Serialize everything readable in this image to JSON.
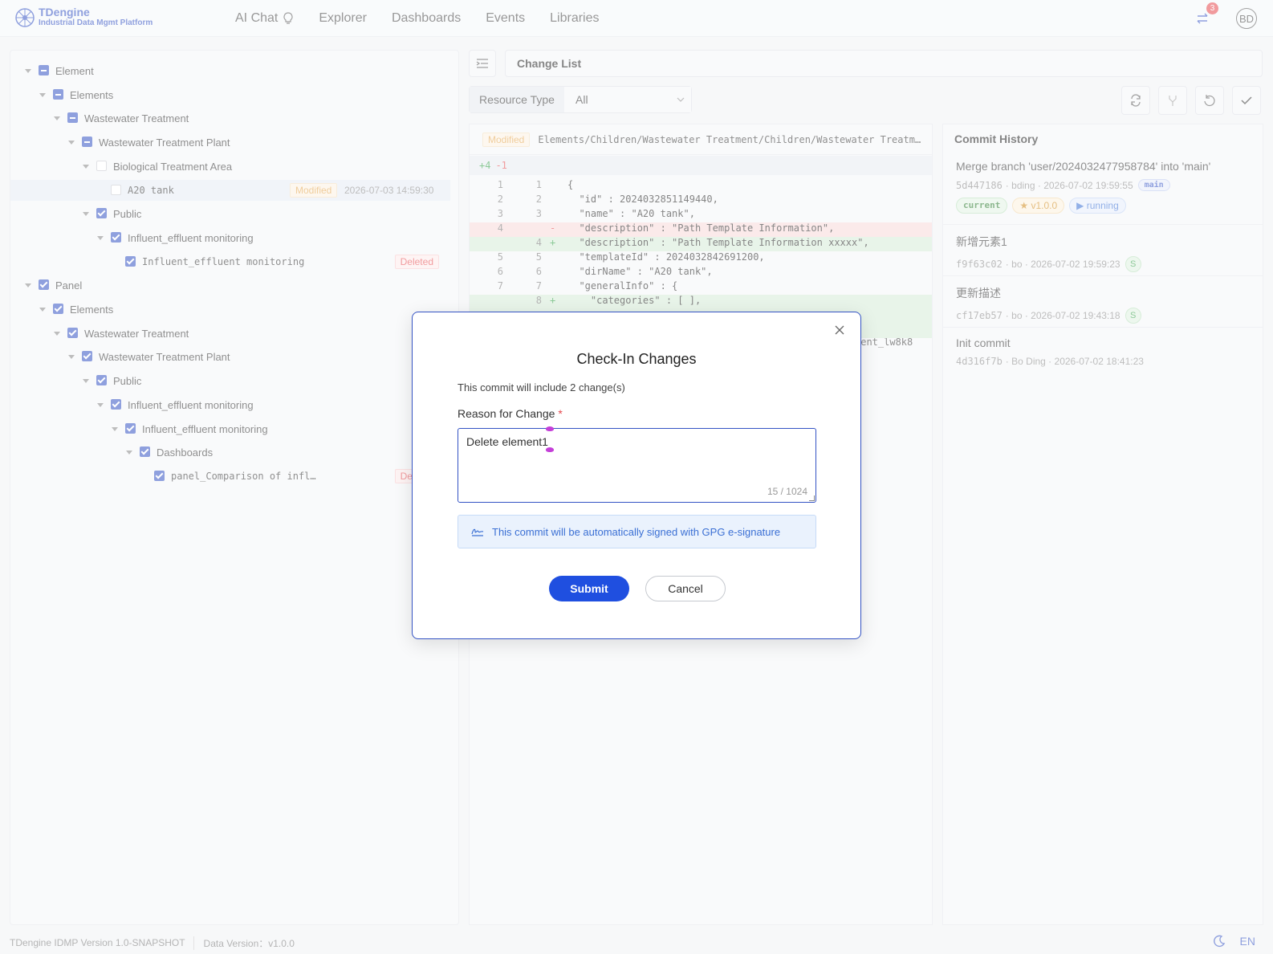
{
  "header": {
    "brand": "TDengine",
    "brand_sub": "Industrial Data Mgmt Platform",
    "nav": [
      {
        "label": "AI Chat",
        "icon": "bulb-icon"
      },
      {
        "label": "Explorer"
      },
      {
        "label": "Dashboards"
      },
      {
        "label": "Events"
      },
      {
        "label": "Libraries"
      }
    ],
    "sync_count": "3",
    "avatar": "BD"
  },
  "tree": [
    {
      "label": "Element",
      "check": "partial",
      "caret": true,
      "mono": false
    },
    {
      "label": "Elements",
      "check": "partial",
      "caret": true,
      "mono": false
    },
    {
      "label": "Wastewater Treatment",
      "check": "partial",
      "caret": true,
      "mono": false
    },
    {
      "label": "Wastewater Treatment Plant",
      "check": "partial",
      "caret": true,
      "mono": false
    },
    {
      "label": "Biological Treatment Area",
      "check": "empty",
      "caret": true,
      "mono": false
    },
    {
      "label": "A20 tank",
      "check": "empty",
      "caret": false,
      "mono": true,
      "tag": "Modified",
      "time": "2026-07-03 14:59:30"
    },
    {
      "label": "Public",
      "check": "checked",
      "caret": true,
      "mono": false
    },
    {
      "label": "Influent_effluent monitoring",
      "check": "checked",
      "caret": true,
      "mono": false
    },
    {
      "label": "Influent_effluent monitoring",
      "check": "checked",
      "caret": false,
      "mono": true,
      "tag": "Deleted"
    },
    {
      "label": "Panel",
      "check": "checked",
      "caret": true,
      "mono": false
    },
    {
      "label": "Elements",
      "check": "checked",
      "caret": true,
      "mono": false
    },
    {
      "label": "Wastewater Treatment",
      "check": "checked",
      "caret": true,
      "mono": false
    },
    {
      "label": "Wastewater Treatment Plant",
      "check": "checked",
      "caret": true,
      "mono": false
    },
    {
      "label": "Public",
      "check": "checked",
      "caret": true,
      "mono": false
    },
    {
      "label": "Influent_effluent monitoring",
      "check": "checked",
      "caret": true,
      "mono": false
    },
    {
      "label": "Influent_effluent monitoring",
      "check": "checked",
      "caret": true,
      "mono": false
    },
    {
      "label": "Dashboards",
      "check": "checked",
      "caret": true,
      "mono": false
    },
    {
      "label": "panel_Comparison of infl…",
      "check": "checked",
      "caret": false,
      "mono": true,
      "tag": "Deleted"
    }
  ],
  "change_list": {
    "title": "Change List",
    "resource_type_label": "Resource Type",
    "resource_type_value": "All",
    "diff": {
      "status": "Modified",
      "path": "Elements/Children/Wastewater Treatment/Children/Wastewater Treatment Pl…",
      "added": "+4",
      "removed": "-1",
      "lines": [
        {
          "old": "1",
          "new": "1",
          "sign": "",
          "text": "{",
          "kind": "ctx"
        },
        {
          "old": "2",
          "new": "2",
          "sign": "",
          "text": "  \"id\" : 2024032851149440,",
          "kind": "ctx"
        },
        {
          "old": "3",
          "new": "3",
          "sign": "",
          "text": "  \"name\" : \"A20 tank\",",
          "kind": "ctx"
        },
        {
          "old": "4",
          "new": "",
          "sign": "-",
          "text": "  \"description\" : \"Path Template Information\",",
          "kind": "del"
        },
        {
          "old": "",
          "new": "4",
          "sign": "+",
          "text": "  \"description\" : \"Path Template Information xxxxx\",",
          "kind": "add"
        },
        {
          "old": "5",
          "new": "5",
          "sign": "",
          "text": "  \"templateId\" : 2024032842691200,",
          "kind": "ctx"
        },
        {
          "old": "6",
          "new": "6",
          "sign": "",
          "text": "  \"dirName\" : \"A20 tank\",",
          "kind": "ctx"
        },
        {
          "old": "7",
          "new": "7",
          "sign": "",
          "text": "  \"generalInfo\" : {",
          "kind": "ctx"
        },
        {
          "old": "",
          "new": "8",
          "sign": "+",
          "text": "    \"categories\" : [ ],",
          "kind": "add"
        }
      ],
      "trailing_fragment": "ment_lw8k8"
    }
  },
  "history": {
    "title": "Commit History",
    "commits": [
      {
        "message": "Merge branch 'user/2024032477958784' into 'main'",
        "hash": "5d447186",
        "author": "bding",
        "time": "2026-07-02 19:59:55",
        "branch": "main",
        "chips": [
          "current",
          "v1.0.0",
          "running"
        ]
      },
      {
        "message": "新增元素1",
        "hash": "f9f63c02",
        "author": "bo",
        "time": "2026-07-02 19:59:23",
        "signed": "S"
      },
      {
        "message": "更新描述",
        "hash": "cf17eb57",
        "author": "bo",
        "time": "2026-07-02 19:43:18",
        "signed": "S"
      },
      {
        "message": "Init commit",
        "hash": "4d316f7b",
        "author": "Bo Ding",
        "time": "2026-07-02 18:41:23"
      }
    ]
  },
  "footer": {
    "version": "TDengine IDMP Version 1.0-SNAPSHOT",
    "data_version": "Data Version：v1.0.0",
    "lang": "EN"
  },
  "modal": {
    "title": "Check-In Changes",
    "subtitle": "This commit will include 2 change(s)",
    "reason_label": "Reason for Change",
    "required_mark": "*",
    "reason_value": "Delete element1",
    "char_count": "15 / 1024",
    "info": "This commit will be automatically signed with GPG e-signature",
    "submit": "Submit",
    "cancel": "Cancel"
  },
  "colors": {
    "accent": "#3453c4",
    "primary_button": "#1f4fe0",
    "deleted": "#e5484d",
    "modified": "#e3a44b",
    "added_line_bg": "#d6ecd8",
    "deleted_line_bg": "#f8d9d9"
  }
}
